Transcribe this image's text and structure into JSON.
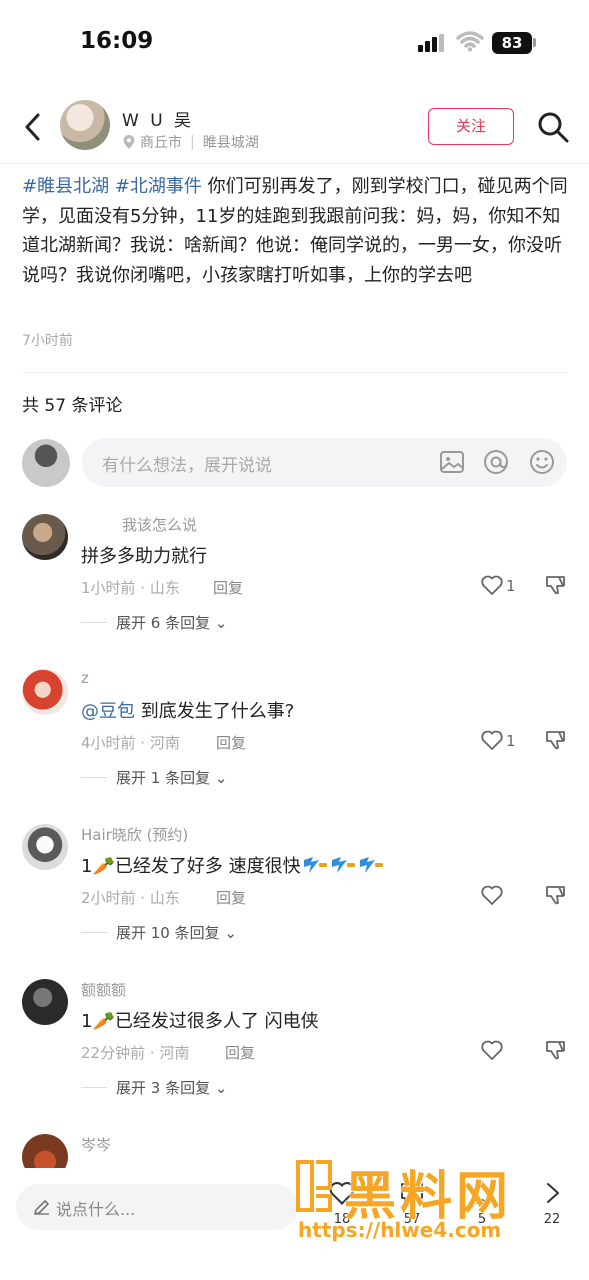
{
  "status": {
    "time": "16:09",
    "battery": "83"
  },
  "header": {
    "username": "W U 吴",
    "location_city": "商丘市",
    "location_place": "睢县城湖",
    "follow_label": "关注"
  },
  "post": {
    "hashtag1": "#睢县北湖",
    "hashtag2": "#北湖事件",
    "text": " 你们可别再发了，刚到学校门口，碰见两个同学，见面没有5分钟，11岁的娃跑到我跟前问我：妈，妈，你知不知道北湖新闻？我说：啥新闻？他说：俺同学说的，一男一女，你没听说吗？我说你闭嘴吧，小孩家瞎打听如事，上你的学去吧",
    "time": "7小时前"
  },
  "comments_count": "共 57 条评论",
  "composer": {
    "placeholder": "有什么想法，展开说说"
  },
  "comments": [
    {
      "nick": "我该怎么说",
      "text": "拼多多助力就行",
      "meta": "1小时前 · 山东",
      "reply": "回复",
      "likes": "1",
      "expand": "展开 6 条回复"
    },
    {
      "nick": "z",
      "mention": "@豆包",
      "text": " 到底发生了什么事?",
      "meta": "4小时前 · 河南",
      "reply": "回复",
      "likes": "1",
      "expand": "展开 1 条回复"
    },
    {
      "nick": "Hair晓欣 (预约)",
      "text": "1🥕已经发了好多 速度很快",
      "meta": "2小时前 · 山东",
      "reply": "回复",
      "likes": "",
      "expand": "展开 10 条回复"
    },
    {
      "nick": "额额额",
      "text": "1🥕已经发过很多人了 闪电侠",
      "meta": "22分钟前 · 河南",
      "reply": "回复",
      "likes": "",
      "expand": "展开 3 条回复"
    },
    {
      "nick": "岑岑"
    }
  ],
  "bottombar": {
    "placeholder": "说点什么...",
    "likes": "18",
    "comments": "57",
    "stars": "5",
    "shares": "22"
  },
  "watermark": {
    "brand": "黑料网",
    "url": "https://hlwe4.com"
  },
  "colors": {
    "accent": "#e8385a",
    "link": "#3a68a8",
    "watermark": "#f6a623"
  }
}
